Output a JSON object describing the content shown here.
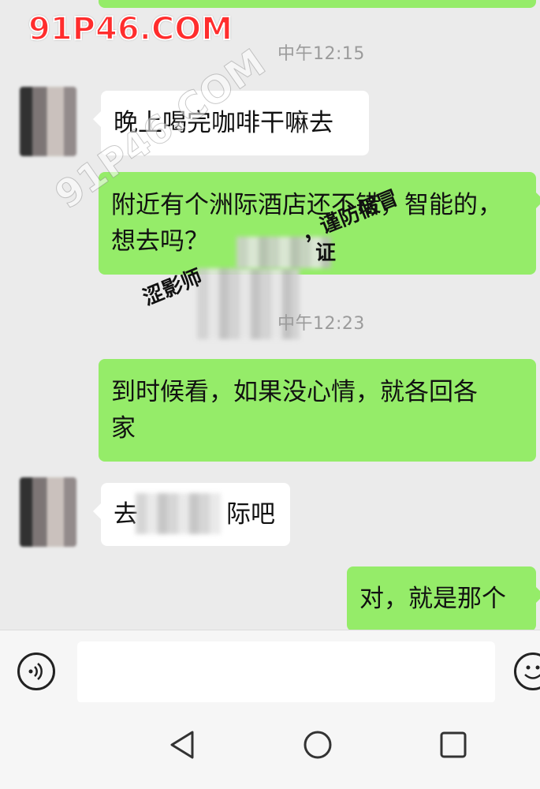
{
  "chat": {
    "timestamps": [
      "中午12:15",
      "中午12:23"
    ],
    "messages": [
      {
        "side": "in",
        "lines": [
          "晚上喝完咖啡干嘛去"
        ]
      },
      {
        "side": "out",
        "lines": [
          "附近有个洲际酒店还不错，智能的，",
          "想去吗？"
        ]
      },
      {
        "side": "out",
        "lines": [
          "到时候看，如果没心情，就各回各",
          "家"
        ]
      },
      {
        "side": "in",
        "lines": [
          "去",
          "际吧"
        ]
      },
      {
        "side": "out",
        "lines": [
          "对，就是那个"
        ]
      }
    ]
  },
  "watermarks": {
    "site": "91P46.COM",
    "diagonal": "91P46.COM",
    "notice_left": "涩影师",
    "notice_right": "，谨防假冒",
    "notice_top": "证"
  },
  "input": {
    "value": "",
    "placeholder": ""
  },
  "icons": {
    "voice": "voice-icon",
    "emoji": "emoji-icon",
    "back": "back-icon",
    "home": "home-icon",
    "recents": "recents-icon"
  },
  "colors": {
    "chat_background": "#ebebeb",
    "outgoing_bubble": "#95ec69",
    "incoming_bubble": "#ffffff",
    "watermark_red": "#ff2d2d"
  }
}
